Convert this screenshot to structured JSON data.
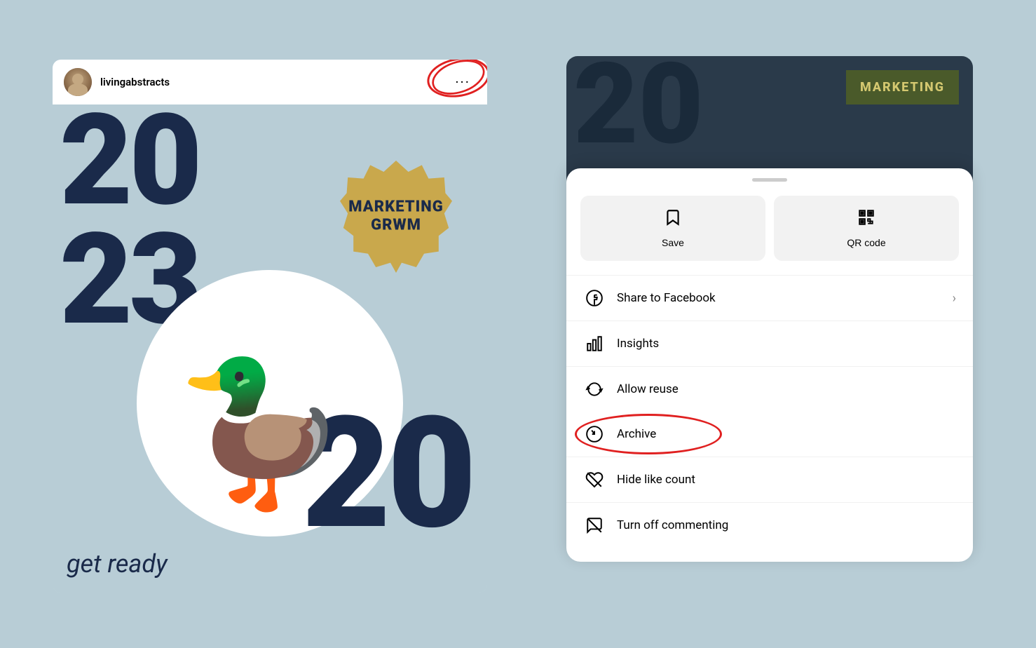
{
  "background_color": "#b8cdd6",
  "left_panel": {
    "username": "livingabstracts",
    "post_numbers": [
      "20",
      "23",
      "20"
    ],
    "badge_text": "MARKETING\nGRWM",
    "get_ready_text": "get ready",
    "more_button": "···"
  },
  "right_panel": {
    "bg_numbers": "20",
    "marketing_label": "MARKETING",
    "drawer": {
      "actions": [
        {
          "label": "Save",
          "icon": "save"
        },
        {
          "label": "QR code",
          "icon": "qr"
        }
      ],
      "menu_items": [
        {
          "label": "Share to Facebook",
          "icon": "facebook",
          "has_chevron": true
        },
        {
          "label": "Insights",
          "icon": "insights",
          "has_chevron": false
        },
        {
          "label": "Allow reuse",
          "icon": "reuse",
          "has_chevron": false
        },
        {
          "label": "Archive",
          "icon": "archive",
          "has_chevron": false,
          "highlighted": true
        },
        {
          "label": "Hide like count",
          "icon": "hide_like",
          "has_chevron": false
        },
        {
          "label": "Turn off commenting",
          "icon": "commenting",
          "has_chevron": false
        }
      ]
    }
  }
}
